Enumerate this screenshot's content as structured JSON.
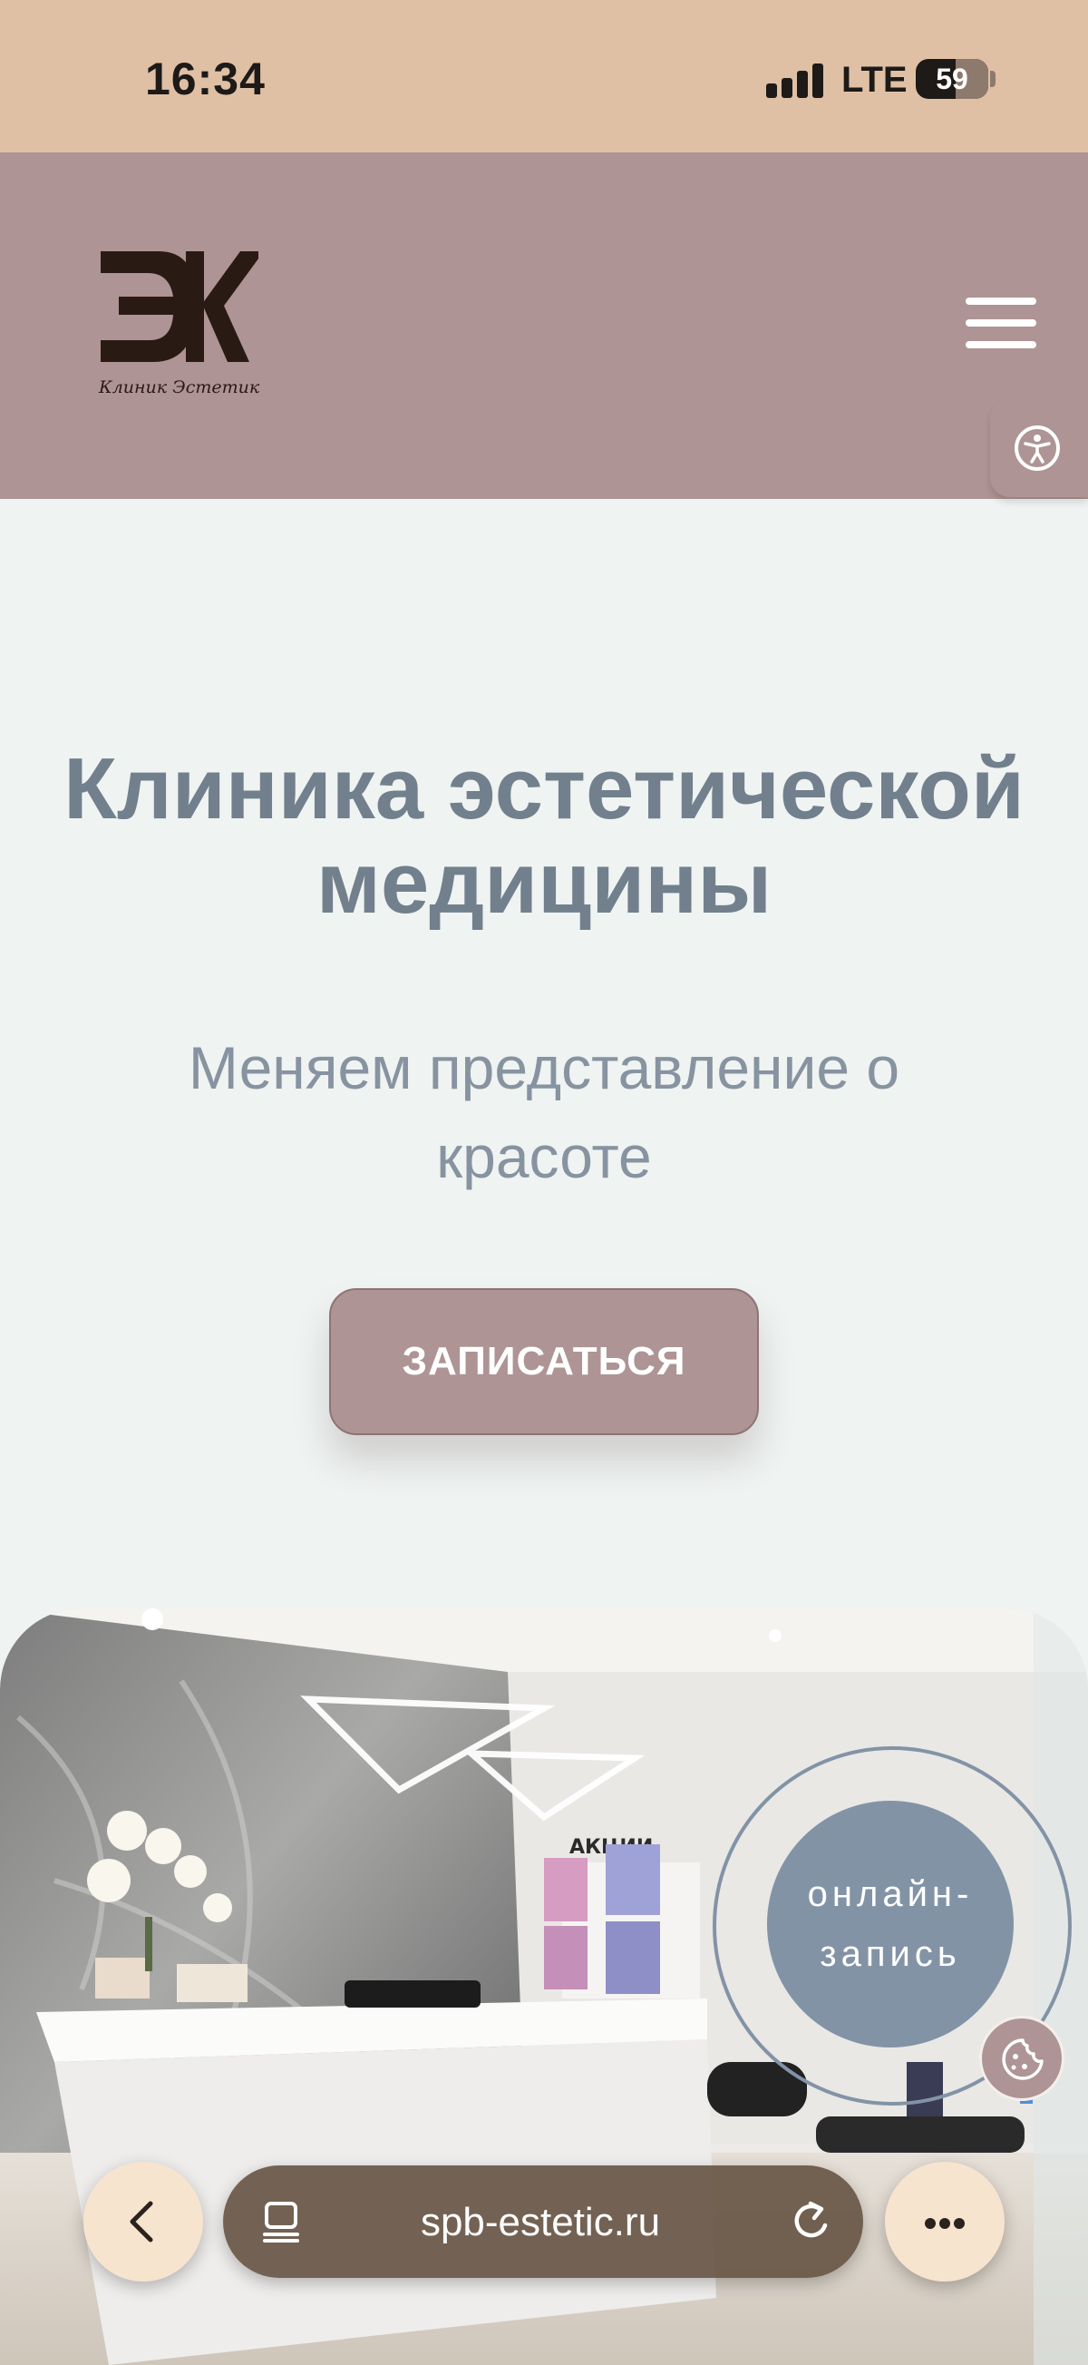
{
  "status_bar": {
    "time": "16:34",
    "network": "LTE",
    "battery": "59"
  },
  "header": {
    "logo_text": "Клиник Эстетик"
  },
  "hero": {
    "title_line1": "Клиника эстетической",
    "title_line2": "медицины",
    "subtitle_line1": "Меняем представление о",
    "subtitle_line2": "красоте",
    "cta_label": "ЗАПИСАТЬСЯ"
  },
  "photo": {
    "sign_text": "АКЦИИ"
  },
  "booking": {
    "line1": "онлайн-",
    "line2": "запись"
  },
  "browser": {
    "url": "spb-estetic.ru"
  },
  "colors": {
    "header_bg": "#ae9494",
    "status_bg": "#dfc0a5",
    "accent_blue": "#8393a6",
    "title_color": "#71808c"
  },
  "icons": [
    "signal-icon",
    "battery-icon",
    "menu-icon",
    "accessibility-icon",
    "cookie-icon",
    "back-arrow-icon",
    "tabs-icon",
    "reload-icon",
    "more-icon"
  ]
}
